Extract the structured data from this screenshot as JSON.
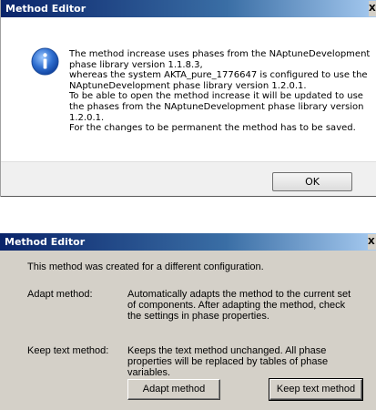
{
  "dialog_info": {
    "title": "Method Editor",
    "close_glyph": "X",
    "icon": "information-icon",
    "message_lines": [
      "The method increase uses phases from the NAptuneDevelopment",
      "phase library version 1.1.8.3,",
      "whereas the system AKTA_pure_1776647 is configured to use the",
      "NAptuneDevelopment phase library version 1.2.0.1.",
      "To be able to open the method increase it will be updated to use",
      "the phases from the NAptuneDevelopment phase library version",
      "1.2.0.1.",
      "For the changes to be permanent the method has to be saved."
    ],
    "ok_label": "OK"
  },
  "dialog_config": {
    "title": "Method Editor",
    "close_glyph": "X",
    "intro": "This method was created for a different configuration.",
    "options": [
      {
        "label": "Adapt method:",
        "description_lines": [
          "Automatically adapts the method to the current set",
          "of components. After adapting the method, check",
          "the settings in phase properties."
        ]
      },
      {
        "label": "Keep text method:",
        "description_lines": [
          "Keeps the text method unchanged. All phase",
          "properties will be replaced by tables of phase",
          "variables."
        ]
      }
    ],
    "adapt_button_label": "Adapt method",
    "keep_button_label": "Keep text method"
  }
}
